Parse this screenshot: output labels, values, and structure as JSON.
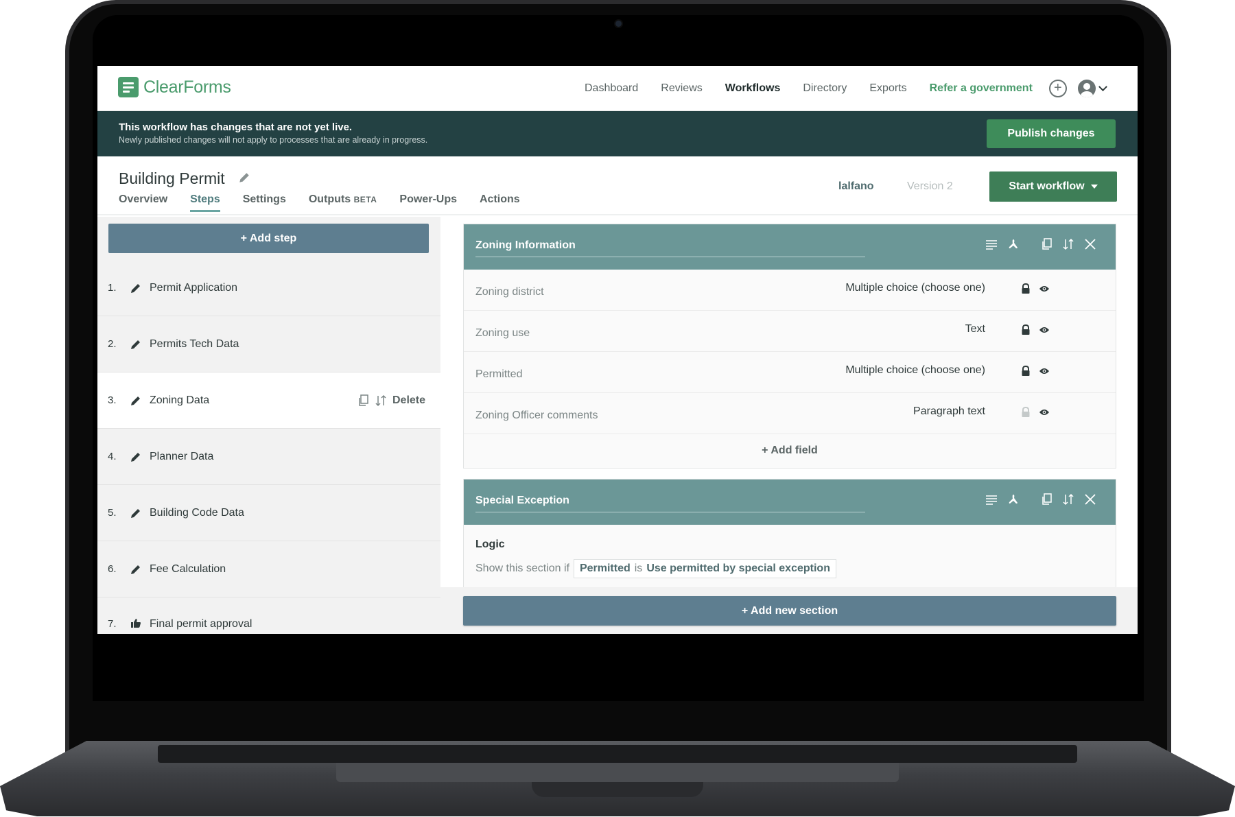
{
  "app": {
    "logo_text": "ClearForms",
    "brand_color": "#4a9b6c"
  },
  "nav": {
    "links": [
      "Dashboard",
      "Reviews",
      "Workflows",
      "Directory",
      "Exports"
    ],
    "active": "Workflows",
    "refer_label": "Refer a government"
  },
  "banner": {
    "title": "This workflow has changes that are not yet live.",
    "subtitle": "Newly published changes will not apply to processes that are already in progress.",
    "publish_label": "Publish changes"
  },
  "workflow": {
    "title": "Building Permit",
    "tabs": [
      {
        "label": "Overview"
      },
      {
        "label": "Steps",
        "active": true
      },
      {
        "label": "Settings"
      },
      {
        "label": "Outputs",
        "badge": "BETA"
      },
      {
        "label": "Power-Ups"
      },
      {
        "label": "Actions"
      }
    ],
    "user": "lalfano",
    "version": "Version 2",
    "start_label": "Start workflow"
  },
  "steps": {
    "add_label": "+ Add step",
    "items": [
      {
        "num": "1.",
        "name": "Permit Application",
        "icon": "pencil-icon"
      },
      {
        "num": "2.",
        "name": "Permits Tech Data",
        "icon": "pencil-icon"
      },
      {
        "num": "3.",
        "name": "Zoning Data",
        "icon": "pencil-icon",
        "selected": true
      },
      {
        "num": "4.",
        "name": "Planner Data",
        "icon": "pencil-icon"
      },
      {
        "num": "5.",
        "name": "Building Code Data",
        "icon": "pencil-icon"
      },
      {
        "num": "6.",
        "name": "Fee Calculation",
        "icon": "pencil-icon"
      },
      {
        "num": "7.",
        "name": "Final permit approval",
        "icon": "thumbs-up-icon"
      }
    ],
    "delete_label": "Delete"
  },
  "sections": [
    {
      "title": "Zoning Information",
      "fields": [
        {
          "name": "Zoning district",
          "type": "Multiple choice (choose one)",
          "locked": true
        },
        {
          "name": "Zoning use",
          "type": "Text",
          "locked": true
        },
        {
          "name": "Permitted",
          "type": "Multiple choice (choose one)",
          "locked": true
        },
        {
          "name": "Zoning Officer comments",
          "type": "Paragraph text",
          "locked": false
        }
      ],
      "add_field_label": "+ Add field"
    },
    {
      "title": "Special Exception",
      "logic_label": "Logic",
      "logic_prefix": "Show this section if",
      "logic_field": "Permitted",
      "logic_op": "is",
      "logic_value": "Use permitted by special exception"
    }
  ],
  "add_section_label": "+ Add new section",
  "colors": {
    "banner": "#234143",
    "publish": "#3e8c5a",
    "start": "#3e7e57",
    "section_header": "#6b9797",
    "blue_button": "#5e7e90"
  }
}
